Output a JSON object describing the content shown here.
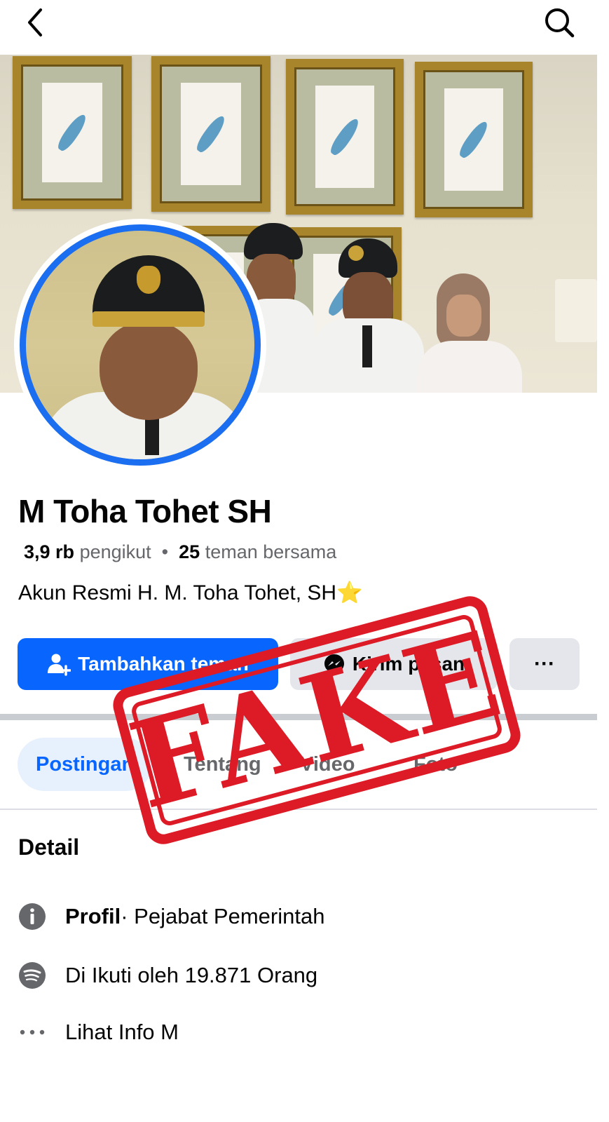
{
  "profile": {
    "name": "M Toha Tohet SH",
    "followers_count": "3,9 rb",
    "followers_label": "pengikut",
    "separator": "•",
    "mutual_count": "25",
    "mutual_label": "teman bersama",
    "bio": "Akun Resmi H. M. Toha Tohet, SH⭐"
  },
  "actions": {
    "add_friend": "Tambahkan teman",
    "message": "Kirim pesan",
    "more": "···"
  },
  "tabs": [
    {
      "label": "Postingan"
    },
    {
      "label": "Tentang"
    },
    {
      "label": "Video"
    },
    {
      "label": "Foto"
    }
  ],
  "details": {
    "title": "Detail",
    "items": [
      {
        "bold": "Profil",
        "text": " · Pejabat Pemerintah"
      },
      {
        "bold": "",
        "text": "Di Ikuti oleh 19.871 Orang"
      },
      {
        "bold": "",
        "text": "Lihat Info M"
      }
    ]
  },
  "stamp": {
    "text": "FAKE",
    "color": "#dd1b27"
  },
  "colors": {
    "primary": "#0866ff",
    "avatar_ring": "#1b6ef0",
    "secondary_btn": "#e4e6eb"
  },
  "icons": [
    "back-arrow-icon",
    "search-icon",
    "add-friend-icon",
    "messenger-icon",
    "more-icon",
    "info-icon",
    "spotify-icon",
    "ellipsis-icon"
  ]
}
